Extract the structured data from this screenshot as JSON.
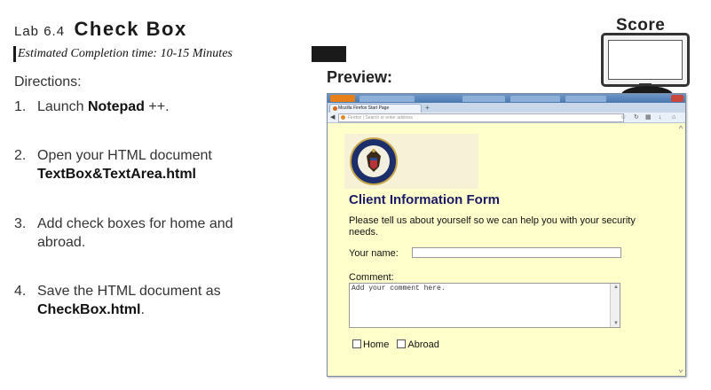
{
  "header": {
    "lab_number": "Lab 6.4",
    "lab_title": "Check Box",
    "estimated_time": "Estimated Completion time: 10-15 Minutes",
    "score_label": "Score"
  },
  "directions": {
    "label": "Directions:",
    "steps": [
      {
        "num": "1.",
        "text": "Launch ",
        "bold": "Notepad",
        "after": " ++."
      },
      {
        "num": "2.",
        "text": "Open your HTML document",
        "bold": "TextBox&TextArea.html"
      },
      {
        "num": "3.",
        "text": "Add check boxes for home and",
        "text2": "abroad."
      },
      {
        "num": "4.",
        "text": "Save the HTML document as",
        "bold": "CheckBox.html",
        "after": "."
      }
    ]
  },
  "preview": {
    "label": "Preview:",
    "browser": {
      "app_button": "Firefox",
      "tab_label": "Mozilla Firefox Start Page",
      "new_tab": "+",
      "url_placeholder": "Firefox | Search or enter address",
      "icons": [
        "back-arrow-icon",
        "star-icon",
        "reload-icon",
        "bookmarks-icon",
        "download-icon",
        "home-icon"
      ]
    },
    "page": {
      "logo": "nsa-seal",
      "form_title": "Client Information Form",
      "intro": "Please tell us about yourself so we can help you with your security needs.",
      "name_label": "Your name:",
      "name_value": "",
      "comment_label": "Comment:",
      "comment_placeholder": "Add your comment here.",
      "checkboxes": [
        {
          "label": "Home",
          "checked": false
        },
        {
          "label": "Abroad",
          "checked": false
        }
      ]
    }
  },
  "colors": {
    "page_background": "#ffffcc",
    "form_title": "#1a1a66",
    "titlebar": "#5a86bc"
  }
}
